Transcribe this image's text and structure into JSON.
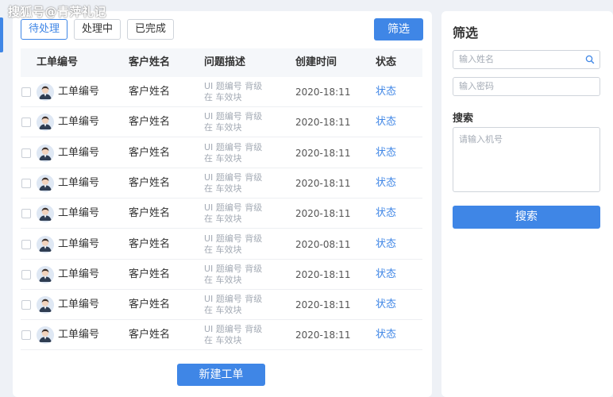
{
  "watermark": "搜狐号@青萍礼记",
  "tabs": [
    {
      "label": "待处理",
      "active": true
    },
    {
      "label": "处理中",
      "active": false
    },
    {
      "label": "已完成",
      "active": false
    }
  ],
  "toolbar": {
    "filter_label": "筛选"
  },
  "table": {
    "columns": [
      "工单编号",
      "客户姓名",
      "问题描述",
      "创建时间",
      "状态"
    ],
    "rows": [
      {
        "id": "工单编号",
        "name": "客户姓名",
        "desc1": "UI 题编号  背级",
        "desc2": "在 车效块",
        "time": "2020-18:11",
        "status": "状态"
      },
      {
        "id": "工单编号",
        "name": "客户姓名",
        "desc1": "UI 题编号  背级",
        "desc2": "在 车效块",
        "time": "2020-18:11",
        "status": "状态"
      },
      {
        "id": "工单编号",
        "name": "客户姓名",
        "desc1": "UI 题编号  背级",
        "desc2": "在 车效块",
        "time": "2020-18:11",
        "status": "状态"
      },
      {
        "id": "工单编号",
        "name": "客户姓名",
        "desc1": "UI 题编号  背级",
        "desc2": "在 车效块",
        "time": "2020-18:11",
        "status": "状态"
      },
      {
        "id": "工单编号",
        "name": "客户姓名",
        "desc1": "UI 题编号  背级",
        "desc2": "在 车效块",
        "time": "2020-18:11",
        "status": "状态"
      },
      {
        "id": "工单编号",
        "name": "客户姓名",
        "desc1": "UI 题编号  背级",
        "desc2": "在 车效块",
        "time": "2020-08:11",
        "status": "状态"
      },
      {
        "id": "工单编号",
        "name": "客户姓名",
        "desc1": "UI 题编号  背级",
        "desc2": "在 车效块",
        "time": "2020-18:11",
        "status": "状态"
      },
      {
        "id": "工单编号",
        "name": "客户姓名",
        "desc1": "UI 题编号  背级",
        "desc2": "在 车效块",
        "time": "2020-18:11",
        "status": "状态"
      },
      {
        "id": "工单编号",
        "name": "客户姓名",
        "desc1": "UI 题编号  背级",
        "desc2": "在 车效块",
        "time": "2020-18:11",
        "status": "状态"
      }
    ]
  },
  "new_ticket_label": "新建工单",
  "sidebar": {
    "title": "筛选",
    "name_placeholder": "输入姓名",
    "password_placeholder": "输入密码",
    "search_section_label": "搜索",
    "phone_placeholder": "请输入机号",
    "search_button_label": "搜索"
  },
  "colors": {
    "accent": "#3f86e6",
    "background": "#eef1f6",
    "muted_text": "#a4abb5"
  },
  "icons": {
    "search": "search-icon",
    "avatar": "user-avatar"
  }
}
